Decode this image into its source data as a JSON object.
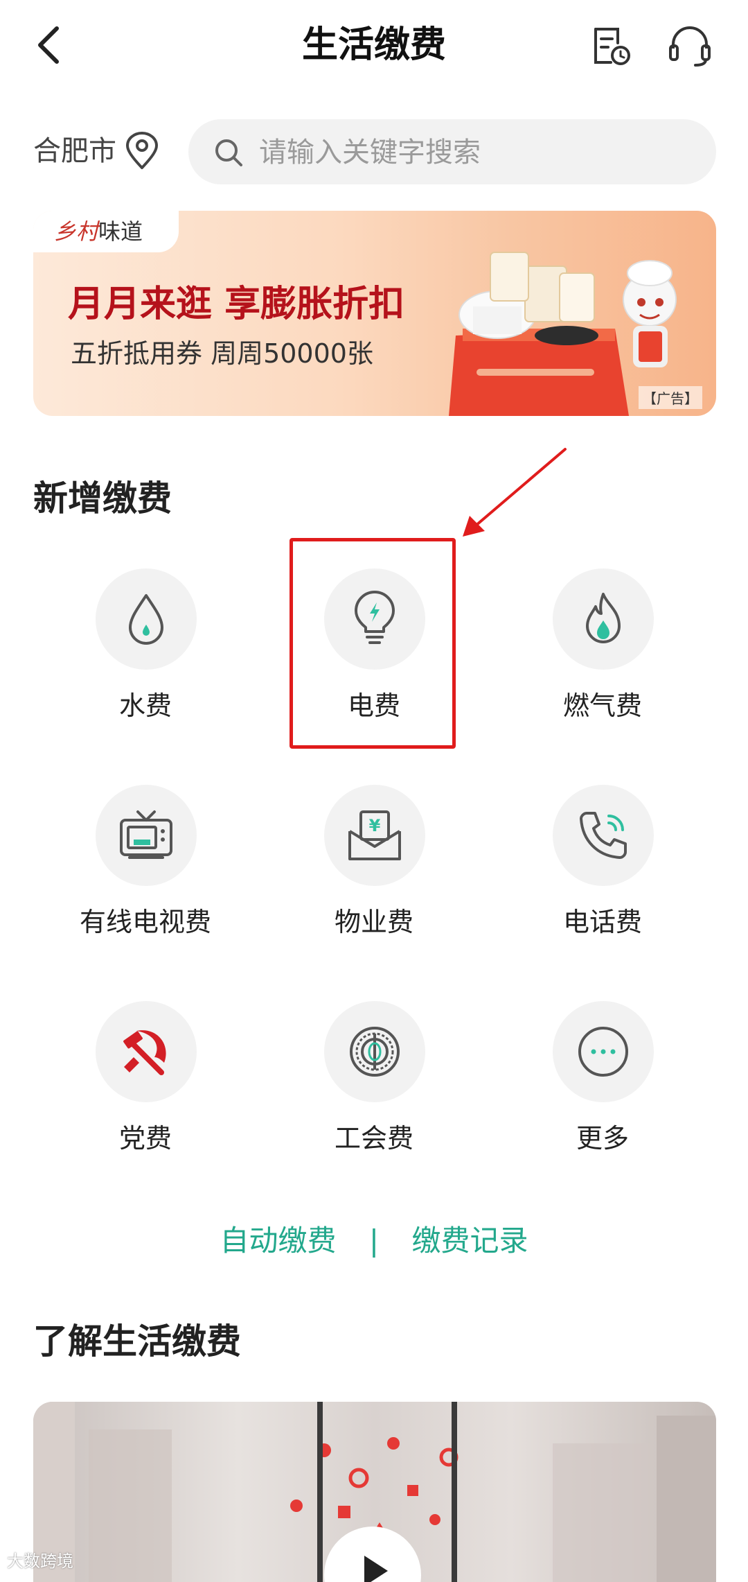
{
  "header": {
    "title": "生活缴费",
    "back_icon": "chevron-left-icon",
    "bill_icon": "bill-clock-icon",
    "service_icon": "headset-icon"
  },
  "location": {
    "city": "合肥市",
    "search_placeholder": "请输入关键字搜索"
  },
  "banner": {
    "brand_part1": "乡村",
    "brand_part2": "味道",
    "headline": "月月来逛 享膨胀折扣",
    "subline": "五折抵用券 周周50000张",
    "ad_label": "【广告】"
  },
  "new_payment": {
    "section_title": "新增缴费",
    "items": [
      {
        "label": "水费",
        "icon": "water-drop-icon"
      },
      {
        "label": "电费",
        "icon": "lightbulb-icon"
      },
      {
        "label": "燃气费",
        "icon": "flame-icon"
      },
      {
        "label": "有线电视费",
        "icon": "tv-icon"
      },
      {
        "label": "物业费",
        "icon": "yen-envelope-icon"
      },
      {
        "label": "电话费",
        "icon": "phone-icon"
      },
      {
        "label": "党费",
        "icon": "hammer-sickle-icon"
      },
      {
        "label": "工会费",
        "icon": "union-emblem-icon"
      },
      {
        "label": "更多",
        "icon": "more-dots-icon"
      }
    ]
  },
  "links": {
    "auto_pay": "自动缴费",
    "separator": "|",
    "history": "缴费记录"
  },
  "learn": {
    "section_title": "了解生活缴费"
  },
  "watermark": "大数跨境",
  "colors": {
    "accent": "#23a88c",
    "highlight": "#e01c1c",
    "icon_stroke": "#555555"
  }
}
